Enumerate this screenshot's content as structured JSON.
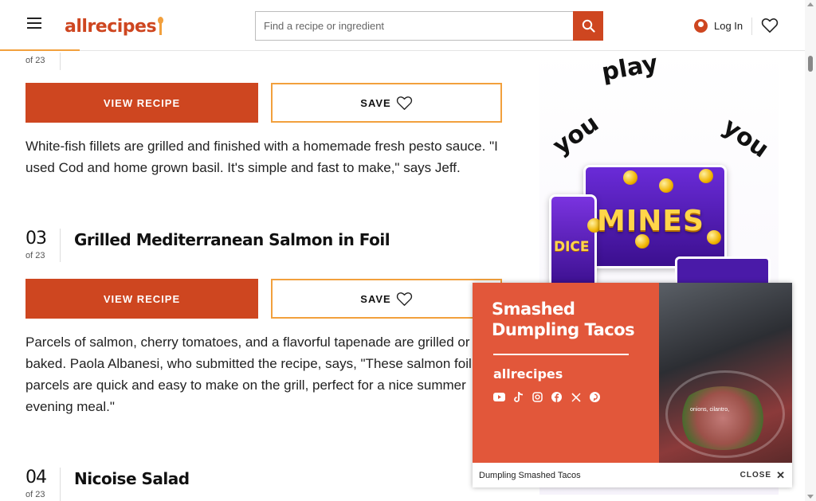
{
  "header": {
    "logo": "allrecipes",
    "search_placeholder": "Find a recipe or ingredient",
    "login_label": "Log In"
  },
  "recipes": [
    {
      "num_of": "of 23",
      "view_label": "VIEW RECIPE",
      "save_label": "SAVE",
      "description": "White-fish fillets are grilled and finished with a homemade fresh pesto sauce. \"I used Cod and home grown basil. It's simple and fast to make,\" says Jeff."
    },
    {
      "num": "03",
      "num_of": "of 23",
      "title": "Grilled Mediterranean Salmon in Foil",
      "view_label": "VIEW RECIPE",
      "save_label": "SAVE",
      "description": "Parcels of salmon, cherry tomatoes, and a flavorful tapenade are grilled or baked. Paola Albanesi, who submitted the recipe, says, \"These salmon foil parcels are quick and easy to make on the grill, perfect for a nice summer evening meal.\""
    },
    {
      "num": "04",
      "num_of": "of 23",
      "title": "Nicoise Salad"
    }
  ],
  "ad_right": {
    "word_play": "play",
    "word_you_left": "you",
    "word_you_right": "you",
    "game_title": "MINES",
    "game_dice": "DICE"
  },
  "video_ad": {
    "headline_1": "Smashed",
    "headline_2": "Dumpling Tacos",
    "brand": "allrecipes",
    "social_icons": [
      "youtube-icon",
      "tiktok-icon",
      "instagram-icon",
      "facebook-icon",
      "x-icon",
      "pinterest-icon"
    ],
    "subtitle": "onions, cilantro,",
    "caption": "Dumpling Smashed Tacos",
    "close_label": "CLOSE"
  },
  "colors": {
    "brand": "#ce4620",
    "accent": "#f2a03d",
    "ad_orange": "#e2573a"
  }
}
